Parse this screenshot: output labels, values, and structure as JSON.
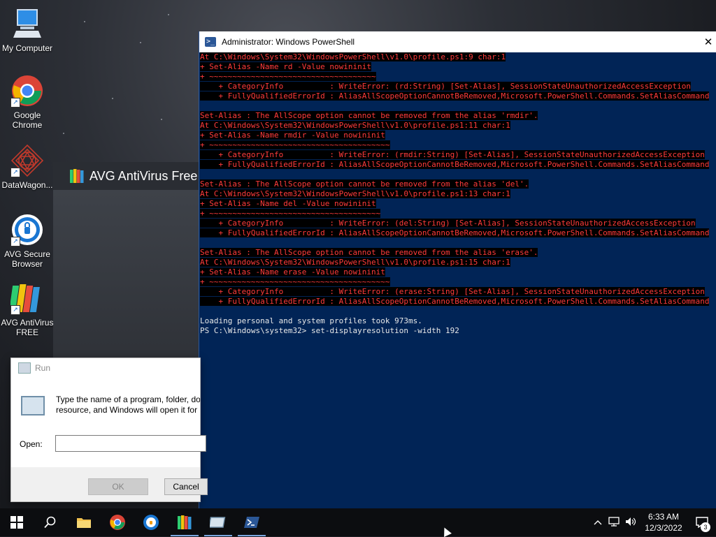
{
  "desktop": {
    "icons": [
      {
        "label": "My Computer"
      },
      {
        "label": "Google Chrome"
      },
      {
        "label": "DataWagon..."
      },
      {
        "label": "AVG Secure Browser"
      },
      {
        "label": "AVG AntiVirus FREE"
      }
    ]
  },
  "avg_splash": {
    "title": "AVG AntiVirus Free"
  },
  "powershell": {
    "title": "Administrator: Windows PowerShell",
    "lines": [
      {
        "kind": "err",
        "text": "At C:\\Windows\\System32\\WindowsPowerShell\\v1.0\\profile.ps1:9 char:1"
      },
      {
        "kind": "err",
        "text": "+ Set-Alias -Name rd -Value nowininit"
      },
      {
        "kind": "err",
        "text": "+ ~~~~~~~~~~~~~~~~~~~~~~~~~~~~~~~~~~~~"
      },
      {
        "kind": "err",
        "text": "    + CategoryInfo          : WriteError: (rd:String) [Set-Alias], SessionStateUnauthorizedAccessException"
      },
      {
        "kind": "err",
        "text": "    + FullyQualifiedErrorId : AliasAllScopeOptionCannotBeRemoved,Microsoft.PowerShell.Commands.SetAliasCommand"
      },
      {
        "kind": "blank",
        "text": ""
      },
      {
        "kind": "err",
        "text": "Set-Alias : The AllScope option cannot be removed from the alias 'rmdir'."
      },
      {
        "kind": "err",
        "text": "At C:\\Windows\\System32\\WindowsPowerShell\\v1.0\\profile.ps1:11 char:1"
      },
      {
        "kind": "err",
        "text": "+ Set-Alias -Name rmdir -Value nowininit"
      },
      {
        "kind": "err",
        "text": "+ ~~~~~~~~~~~~~~~~~~~~~~~~~~~~~~~~~~~~~~~"
      },
      {
        "kind": "err",
        "text": "    + CategoryInfo          : WriteError: (rmdir:String) [Set-Alias], SessionStateUnauthorizedAccessException"
      },
      {
        "kind": "err",
        "text": "    + FullyQualifiedErrorId : AliasAllScopeOptionCannotBeRemoved,Microsoft.PowerShell.Commands.SetAliasCommand"
      },
      {
        "kind": "blank",
        "text": ""
      },
      {
        "kind": "err",
        "text": "Set-Alias : The AllScope option cannot be removed from the alias 'del'."
      },
      {
        "kind": "err",
        "text": "At C:\\Windows\\System32\\WindowsPowerShell\\v1.0\\profile.ps1:13 char:1"
      },
      {
        "kind": "err",
        "text": "+ Set-Alias -Name del -Value nowininit"
      },
      {
        "kind": "err",
        "text": "+ ~~~~~~~~~~~~~~~~~~~~~~~~~~~~~~~~~~~~~"
      },
      {
        "kind": "err",
        "text": "    + CategoryInfo          : WriteError: (del:String) [Set-Alias], SessionStateUnauthorizedAccessException"
      },
      {
        "kind": "err",
        "text": "    + FullyQualifiedErrorId : AliasAllScopeOptionCannotBeRemoved,Microsoft.PowerShell.Commands.SetAliasCommand"
      },
      {
        "kind": "blank",
        "text": ""
      },
      {
        "kind": "err",
        "text": "Set-Alias : The AllScope option cannot be removed from the alias 'erase'."
      },
      {
        "kind": "err",
        "text": "At C:\\Windows\\System32\\WindowsPowerShell\\v1.0\\profile.ps1:15 char:1"
      },
      {
        "kind": "err",
        "text": "+ Set-Alias -Name erase -Value nowininit"
      },
      {
        "kind": "err",
        "text": "+ ~~~~~~~~~~~~~~~~~~~~~~~~~~~~~~~~~~~~~~~"
      },
      {
        "kind": "err",
        "text": "    + CategoryInfo          : WriteError: (erase:String) [Set-Alias], SessionStateUnauthorizedAccessException"
      },
      {
        "kind": "err",
        "text": "    + FullyQualifiedErrorId : AliasAllScopeOptionCannotBeRemoved,Microsoft.PowerShell.Commands.SetAliasCommand"
      },
      {
        "kind": "blank",
        "text": ""
      },
      {
        "kind": "norm",
        "text": "Loading personal and system profiles took 973ms."
      }
    ],
    "prompt": {
      "path": "PS C:\\Windows\\system32> ",
      "command": "set-displayresolution",
      "param": " -width",
      "value": " 192"
    }
  },
  "run_dialog": {
    "title": "Run",
    "description_line1": "Type the name of a program, folder, do",
    "description_line2": "resource, and Windows will open it for",
    "open_label": "Open:",
    "open_value": "",
    "ok_label": "OK",
    "cancel_label": "Cancel"
  },
  "taskbar": {
    "time": "6:33 AM",
    "date": "12/3/2022",
    "notification_count": "3",
    "icons": [
      "windows-start-icon",
      "search-icon",
      "file-explorer-icon",
      "chrome-icon",
      "avg-secure-browser-icon",
      "avg-antivirus-icon",
      "run-dialog-icon",
      "powershell-icon"
    ]
  },
  "colors": {
    "powershell_bg": "#012456",
    "error_fg": "#ff3b3b",
    "error_bg": "#000000",
    "taskbar_bg": "#0c0d10"
  }
}
